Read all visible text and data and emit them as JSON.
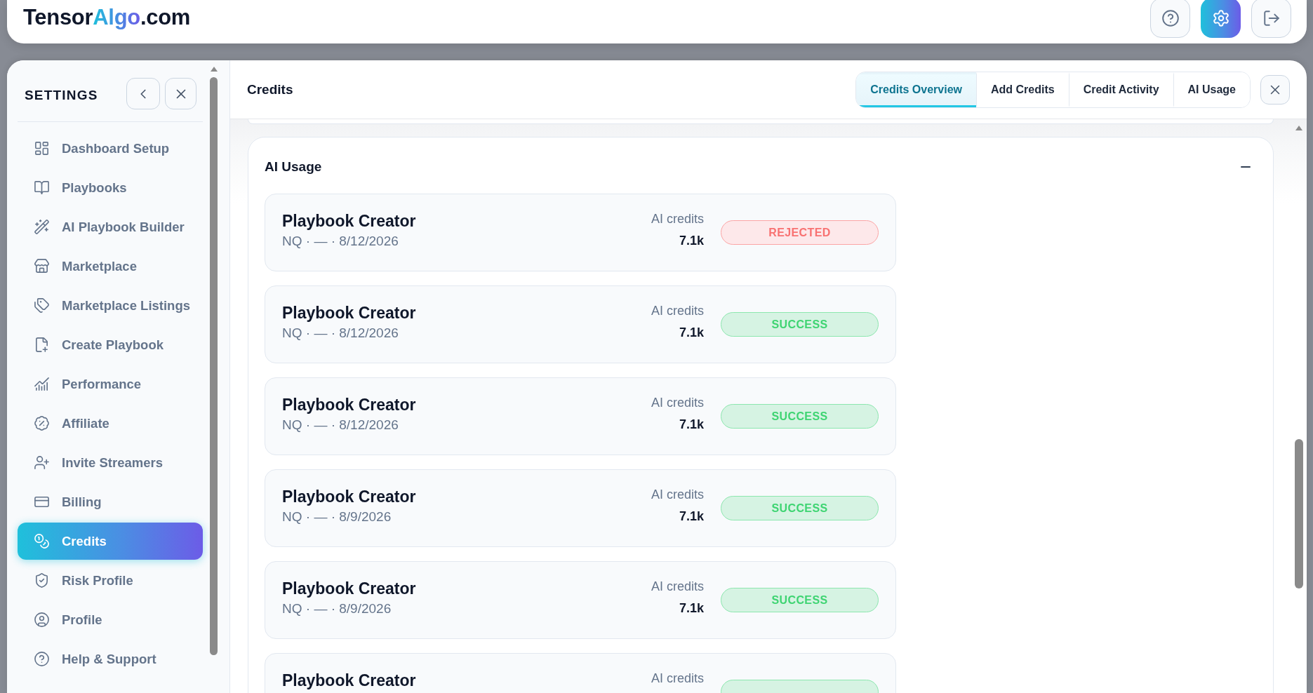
{
  "header": {
    "logo": {
      "prefix": "Tensor",
      "highlight": "Algo",
      "suffix": ".com"
    },
    "actions": [
      {
        "kind": "help",
        "selected": false
      },
      {
        "kind": "settings",
        "selected": true
      },
      {
        "kind": "logout",
        "selected": false
      }
    ]
  },
  "sidebar": {
    "title": "SETTINGS",
    "items": [
      {
        "label": "Dashboard Setup",
        "selected": false
      },
      {
        "label": "Playbooks",
        "selected": false
      },
      {
        "label": "AI Playbook Builder",
        "selected": false
      },
      {
        "label": "Marketplace",
        "selected": false
      },
      {
        "label": "Marketplace Listings",
        "selected": false
      },
      {
        "label": "Create Playbook",
        "selected": false
      },
      {
        "label": "Performance",
        "selected": false
      },
      {
        "label": "Affiliate",
        "selected": false
      },
      {
        "label": "Invite Streamers",
        "selected": false
      },
      {
        "label": "Billing",
        "selected": false
      },
      {
        "label": "Credits",
        "selected": true
      },
      {
        "label": "Risk Profile",
        "selected": false
      },
      {
        "label": "Profile",
        "selected": false
      },
      {
        "label": "Help & Support",
        "selected": false
      }
    ]
  },
  "content": {
    "title": "Credits",
    "tabs": [
      {
        "label": "Credits Overview",
        "selected": true
      },
      {
        "label": "Add Credits",
        "selected": false
      },
      {
        "label": "Credit Activity",
        "selected": false
      },
      {
        "label": "AI Usage",
        "selected": false
      }
    ],
    "section": {
      "title": "AI Usage",
      "expanded": true,
      "rows": [
        {
          "title": "Playbook Creator",
          "meta": "NQ · — · 8/12/2026",
          "credits_label": "AI credits",
          "credits": "7.1k",
          "status": {
            "kind": "rejected",
            "label": "REJECTED"
          }
        },
        {
          "title": "Playbook Creator",
          "meta": "NQ · — · 8/12/2026",
          "credits_label": "AI credits",
          "credits": "7.1k",
          "status": {
            "kind": "success",
            "label": "SUCCESS"
          }
        },
        {
          "title": "Playbook Creator",
          "meta": "NQ · — · 8/12/2026",
          "credits_label": "AI credits",
          "credits": "7.1k",
          "status": {
            "kind": "success",
            "label": "SUCCESS"
          }
        },
        {
          "title": "Playbook Creator",
          "meta": "NQ · — · 8/9/2026",
          "credits_label": "AI credits",
          "credits": "7.1k",
          "status": {
            "kind": "success",
            "label": "SUCCESS"
          }
        },
        {
          "title": "Playbook Creator",
          "meta": "NQ · — · 8/9/2026",
          "credits_label": "AI credits",
          "credits": "7.1k",
          "status": {
            "kind": "success",
            "label": "SUCCESS"
          }
        },
        {
          "title": "Playbook Creator",
          "credits_label": "AI credits",
          "status": {
            "kind": "success"
          }
        }
      ]
    }
  }
}
